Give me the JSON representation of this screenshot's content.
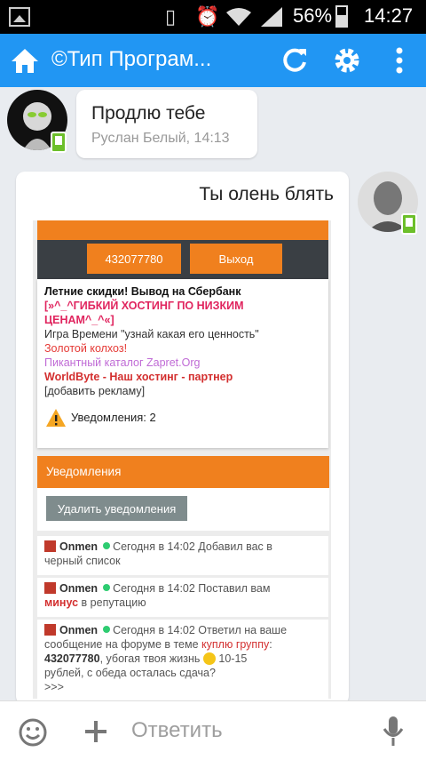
{
  "status_bar": {
    "battery": "56%",
    "time": "14:27",
    "battery_level": 0.56
  },
  "app_bar": {
    "title": "©Тип Програм..."
  },
  "messages": [
    {
      "text": "Продлю тебе",
      "author_time": "Руслан Белый, 14:13"
    },
    {
      "text": "Ты олень блять"
    }
  ],
  "screenshot": {
    "login_value": "432077780",
    "logout_label": "Выход",
    "ads": [
      "Летние скидки! Вывод на Сбербанк",
      "[»^_^ГИБКИЙ ХОСТИНГ ПО НИЗКИМ",
      "ЦЕНАМ^_^«]",
      "Игра Времени \"узнай какая его ценность\"",
      "Золотой колхоз!",
      "Пикантный каталог Zapret.Org",
      "WorldByte - Наш хостинг - партнер",
      "[добавить рекламу]"
    ],
    "notifications_count_label": "Уведомления: 2",
    "notifications_header": "Уведомления",
    "delete_notifications": "Удалить уведомления",
    "notifications": [
      {
        "user": "Onmen",
        "line1": "Сегодня в 14:02 Добавил вас в",
        "line2": "черный список"
      },
      {
        "user": "Onmen",
        "line1": "Сегодня в 14:02 Поставил вам",
        "bold2": "минус",
        "line2": " в репутацию"
      },
      {
        "user": "Onmen",
        "line1": "Сегодня в 14:02 Ответил на ваше",
        "line2a": "сообщение на форуме в теме ",
        "link": "куплю группу",
        "line2b": ":",
        "bold3": "432077780",
        "line3": ", убогая твоя жизнь",
        "line3b": " 10-15",
        "line4": "рублей, с обеда осталась сдача?",
        "line5": ">>>"
      }
    ]
  },
  "composer": {
    "placeholder": "Ответить"
  },
  "colors": {
    "accent": "#2196f3",
    "orange": "#f0801e",
    "dark": "#3a3f44"
  }
}
